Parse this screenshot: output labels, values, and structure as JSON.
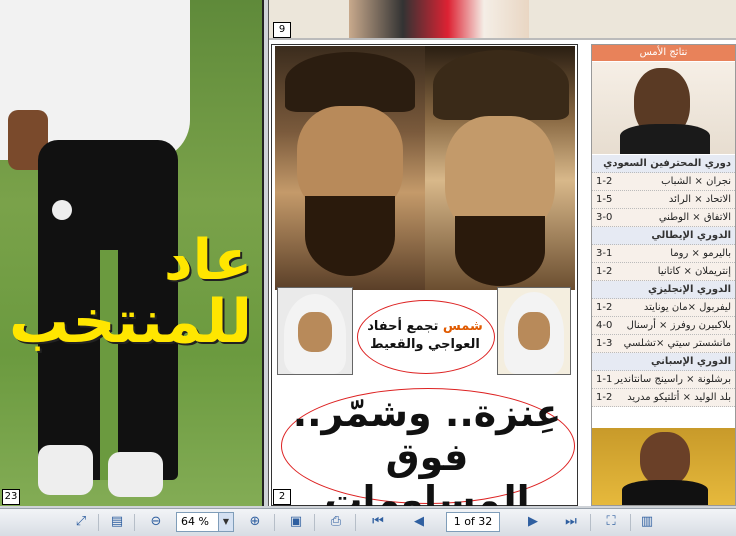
{
  "left_page": {
    "headline_line1": "عاد",
    "headline_line2": "للمنتخب",
    "page_number": "23"
  },
  "right_page": {
    "top_page_number": "9",
    "page_number": "2",
    "caption_brand": "شمس",
    "caption_text": "تجمع أحفاد",
    "caption_line2": "العواجي والقعيط",
    "headline_line1": "عِنزة.. وشمّر..",
    "headline_line2": "فوق المساومات"
  },
  "sidebar": {
    "title": "نتائج الأمس",
    "leagues": [
      {
        "name": "دوري المحترفين السعودي",
        "matches": [
          {
            "teams": "نجران × الشباب",
            "score": "1-2"
          },
          {
            "teams": "الاتحاد × الرائد",
            "score": "1-5"
          },
          {
            "teams": "الاتفاق × الوطني",
            "score": "3-0"
          }
        ]
      },
      {
        "name": "الدوري الإيطالي",
        "matches": [
          {
            "teams": "باليرمو × روما",
            "score": "3-1"
          },
          {
            "teams": "إنتريملان × كاتانيا",
            "score": "1-2"
          }
        ]
      },
      {
        "name": "الدوري الإنجليزي",
        "matches": [
          {
            "teams": "ليفربول ×مان يونايتد",
            "score": "1-2"
          },
          {
            "teams": "بلاكبيرن روفرز × أرسنال",
            "score": "4-0"
          },
          {
            "teams": "مانشستر سيتي ×تشلسي",
            "score": "1-3"
          }
        ]
      },
      {
        "name": "الدوري الإسباني",
        "matches": [
          {
            "teams": "برشلونة × راسينج سانتاندير",
            "score": "1-1"
          },
          {
            "teams": "بلد الوليد × أتلتيكو مدريد",
            "score": "1-2"
          }
        ]
      }
    ]
  },
  "toolbar": {
    "zoom_value": "64 %",
    "page_field": "1 of 32",
    "icons": [
      "fit-page-icon",
      "single-page-icon",
      "zoom-out-icon",
      "zoom-in-icon",
      "save-icon",
      "print-icon",
      "first-page-icon",
      "previous-page-icon",
      "next-page-icon",
      "last-page-icon",
      "fullscreen-icon",
      "two-page-icon"
    ]
  }
}
